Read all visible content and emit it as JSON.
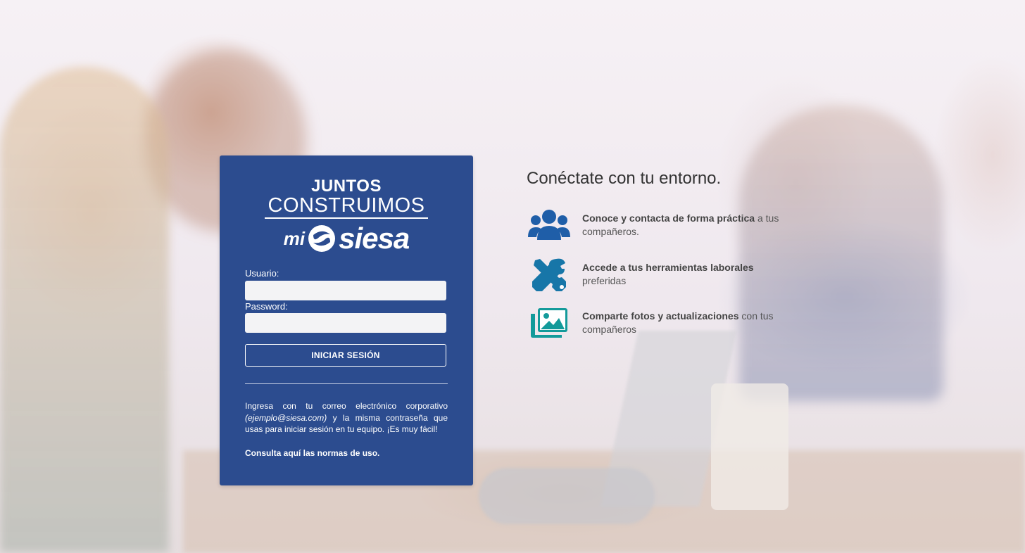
{
  "logo": {
    "line1": "JUNTOS",
    "line2": "CONSTRUIMOS",
    "prefix": "mi",
    "brand": "siesa"
  },
  "login": {
    "user_label": "Usuario:",
    "user_value": "",
    "password_label": "Password:",
    "password_value": "",
    "submit_label": "INICIAR SESIÓN",
    "help_part1": "Ingresa con tu correo electrónico corporativo",
    "help_example": "(ejemplo@siesa.com)",
    "help_part2": "y la misma contraseña que usas para iniciar sesión en tu equipo. ¡Es muy fácil!",
    "terms_link": "Consulta aquí las normas de uso."
  },
  "promo": {
    "headline": "Conéctate con tu entorno.",
    "features": [
      {
        "icon": "users-icon",
        "bold": "Conoce y contacta de forma práctica",
        "rest": " a tus compañeros.",
        "color": "#1f5ea8"
      },
      {
        "icon": "tools-icon",
        "bold": "Accede a tus herramientas laborales",
        "rest": " preferidas",
        "color": "#1776a8"
      },
      {
        "icon": "images-icon",
        "bold": "Comparte fotos y actualizaciones",
        "rest": " con tus compañeros",
        "color": "#139a9a"
      }
    ]
  },
  "colors": {
    "card_bg": "#2c4c8f",
    "input_bg": "#f3f3f5"
  }
}
